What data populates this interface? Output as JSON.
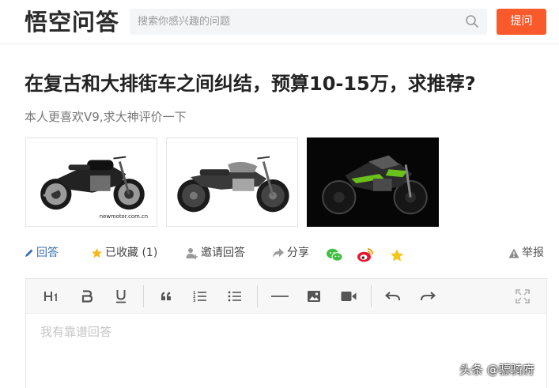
{
  "header": {
    "logo": "悟空问答",
    "search_placeholder": "搜索你感兴趣的问题",
    "ask_label": "提问"
  },
  "question": {
    "title": "在复古和大排街车之间纠结，预算10-15万，求推荐?",
    "description": "本人更喜欢V9,求大神评价一下",
    "images": [
      {
        "caption": "newmotor.com.cn"
      },
      {
        "caption": ""
      },
      {
        "caption": ""
      }
    ]
  },
  "actions": {
    "answer": "回答",
    "collect": "已收藏",
    "collect_count": "(1)",
    "invite": "邀请回答",
    "share": "分享",
    "report": "举报"
  },
  "editor": {
    "toolbar": [
      "H1",
      "B",
      "U",
      "quote",
      "ordered-list",
      "unordered-list",
      "divider",
      "image",
      "video",
      "undo",
      "redo",
      "fullscreen"
    ],
    "placeholder": "我有靠谱回答"
  },
  "watermark": "头条 @骠骑府",
  "colors": {
    "accent": "#f85a2b",
    "link": "#3a6fb7",
    "star": "#f5b91e",
    "wechat": "#3fbf3f",
    "weibo": "#e6162d"
  }
}
